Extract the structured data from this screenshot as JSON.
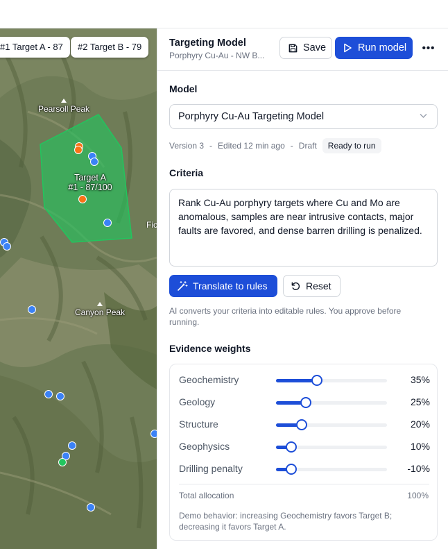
{
  "map": {
    "chips": [
      "#1 Target A - 87",
      "#2 Target B - 79"
    ],
    "peaks": [
      "Pearsoll Peak",
      "Canyon Peak"
    ],
    "target_label_line1": "Target A",
    "target_label_line2": "#1 - 87/100",
    "edge_label": "Fic",
    "colors": {
      "zone_fill": "#22c55e",
      "sample_blue": "#3b82f6",
      "sample_orange": "#f97316",
      "sample_green": "#22c55e"
    }
  },
  "panel": {
    "title": "Targeting Model",
    "subtitle": "Porphyry Cu-Au - NW B...",
    "save_label": "Save",
    "run_label": "Run model",
    "more_label": "•••",
    "model_section": "Model",
    "model_value": "Porphyry Cu-Au Targeting Model",
    "meta": {
      "version": "Version 3",
      "sep": "-",
      "edited": "Edited 12 min ago",
      "draft": "Draft",
      "status": "Ready to run"
    },
    "criteria_section": "Criteria",
    "criteria_text": "Rank Cu-Au porphyry targets where Cu and Mo are anomalous, samples are near intrusive contacts, major faults are favored, and dense barren drilling is penalized.",
    "translate_label": "Translate to rules",
    "reset_label": "Reset",
    "helper_text": "AI converts your criteria into editable rules. You approve before running.",
    "weights_section": "Evidence weights",
    "weights": [
      {
        "label": "Geochemistry",
        "value": "35%",
        "level": 0.37
      },
      {
        "label": "Geology",
        "value": "25%",
        "level": 0.27
      },
      {
        "label": "Structure",
        "value": "20%",
        "level": 0.23
      },
      {
        "label": "Geophysics",
        "value": "10%",
        "level": 0.14
      },
      {
        "label": "Drilling penalty",
        "value": "-10%",
        "level": 0.14
      }
    ],
    "total_label": "Total allocation",
    "total_value": "100%",
    "demo_note": "Demo behavior: increasing Geochemistry favors Target B; decreasing it favors Target A.",
    "accent": "#1d4ed8"
  }
}
